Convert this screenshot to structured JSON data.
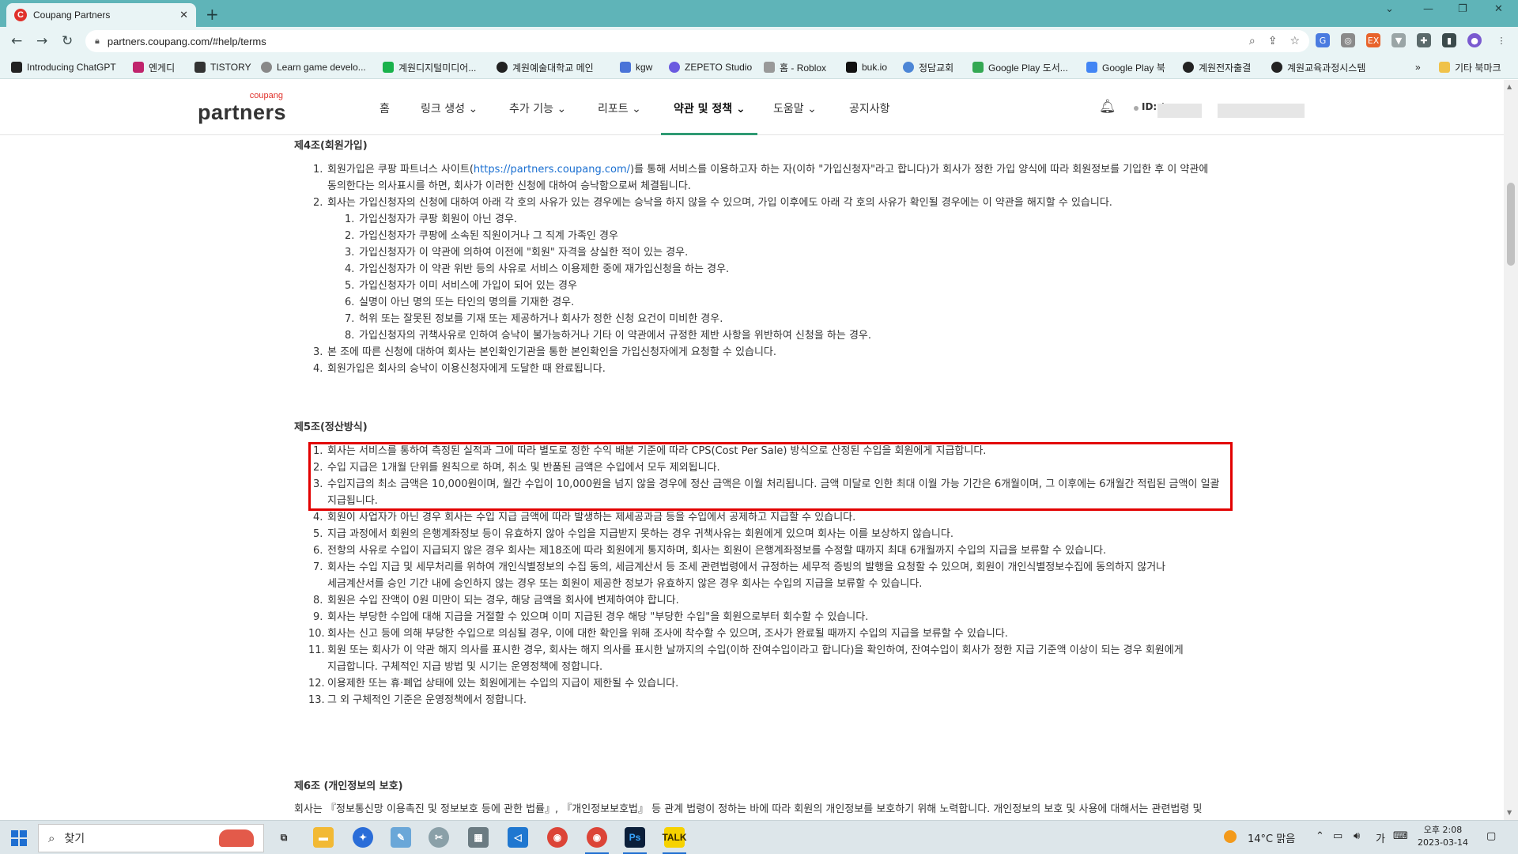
{
  "browser": {
    "tab_title": "Coupang Partners",
    "tab_favicon": "C",
    "url": "partners.coupang.com/#help/terms"
  },
  "bookmarks": [
    {
      "label": "Introducing ChatGPT",
      "color": "#222"
    },
    {
      "label": "엔게디",
      "color": "#c0246c"
    },
    {
      "label": "TISTORY",
      "color": "#333"
    },
    {
      "label": "Learn game develo...",
      "color": "#888"
    },
    {
      "label": "계원디지털미디어...",
      "color": "#19b24b"
    },
    {
      "label": "계원예술대학교 메인",
      "color": "#222"
    },
    {
      "label": "kgw",
      "color": "#4a74d8"
    },
    {
      "label": "ZEPETO Studio",
      "color": "#6a5ae0"
    },
    {
      "label": "홈 - Roblox",
      "color": "#999"
    },
    {
      "label": "buk.io",
      "color": "#111"
    },
    {
      "label": "정담교회",
      "color": "#4c86d6"
    },
    {
      "label": "Google Play 도서...",
      "color": "#34a853"
    },
    {
      "label": "Google Play 북",
      "color": "#4285f4"
    },
    {
      "label": "계원전자출결",
      "color": "#222"
    },
    {
      "label": "계원교육과정시스템",
      "color": "#222"
    }
  ],
  "bookmarks_more": "»",
  "bookmarks_other": "기타 북마크",
  "site": {
    "logo_sub": "coupang",
    "logo_main": "partners",
    "nav": [
      "홈",
      "링크 생성",
      "추가 기능",
      "리포트",
      "약관 및 정책",
      "도움말",
      "공지사항"
    ],
    "user_label": "ID: /"
  },
  "article": {
    "art4_title": "제4조(회원가입)",
    "art4_item1_a_pre": "회원가입은 쿠팡 파트너스 사이트(",
    "art4_item1_a_link": "https://partners.coupang.com/",
    "art4_item1_a_post": ")를 통해 서비스를 이용하고자 하는 자(이하 \"가입신청자\"라고 합니다)가 회사가 정한 가입 양식에 따라 회원정보를 기입한 후 이 약관에",
    "art4_item1_b": "동의한다는 의사표시를 하면, 회사가 이러한 신청에 대하여 승낙함으로써 체결됩니다.",
    "art4_item2": "회사는 가입신청자의 신청에 대하여 아래 각 호의 사유가 있는 경우에는 승낙을 하지 않을 수 있으며, 가입 이후에도 아래 각 호의 사유가 확인될 경우에는 이 약관을 해지할 수 있습니다.",
    "art4_sub": [
      "가입신청자가 쿠팡 회원이 아닌 경우.",
      "가입신청자가 쿠팡에 소속된 직원이거나 그 직계 가족인 경우",
      "가입신청자가 이 약관에 의하여 이전에 \"회원\" 자격을 상실한 적이 있는 경우.",
      "가입신청자가 이 약관 위반 등의 사유로 서비스 이용제한 중에 재가입신청을 하는 경우.",
      "가입신청자가 이미 서비스에 가입이 되어 있는 경우",
      "실명이 아닌 명의 또는 타인의 명의를 기재한 경우.",
      "허위 또는 잘못된 정보를 기재 또는 제공하거나 회사가 정한 신청 요건이 미비한 경우.",
      "가입신청자의 귀책사유로 인하여 승낙이 불가능하거나 기타 이 약관에서 규정한 제반 사항을 위반하여 신청을 하는 경우."
    ],
    "art4_item3": "본 조에 따른 신청에 대하여 회사는 본인확인기관을 통한 본인확인을 가입신청자에게 요청할 수 있습니다.",
    "art4_item4": "회원가입은 회사의 승낙이 이용신청자에게 도달한 때 완료됩니다.",
    "art5_title": "제5조(정산방식)",
    "art5_items": [
      "회사는 서비스를 통하여 측정된 실적과 그에 따라 별도로 정한 수익 배분 기준에 따라 CPS(Cost Per Sale) 방식으로 산정된 수입을 회원에게 지급합니다.",
      "수입 지급은 1개월 단위를 원칙으로 하며, 취소 및 반품된 금액은 수입에서 모두 제외됩니다.",
      "수입지급의 최소 금액은 10,000원이며, 월간 수입이 10,000원을 넘지 않을 경우에 정산 금액은 이월 처리됩니다. 금액 미달로 인한 최대 이월 가능 기간은 6개월이며, 그 이후에는 6개월간 적립된 금액이 일괄",
      "회원이 사업자가 아닌 경우 회사는 수입 지급 금액에 따라 발생하는 제세공과금 등을 수입에서 공제하고 지급할 수 있습니다.",
      "지급 과정에서 회원의 은행계좌정보 등이 유효하지 않아 수입을 지급받지 못하는 경우 귀책사유는 회원에게 있으며 회사는 이를 보상하지 않습니다.",
      "전항의 사유로 수입이 지급되지 않은 경우 회사는 제18조에 따라 회원에게 통지하며, 회사는 회원이 은행계좌정보를 수정할 때까지 최대 6개월까지 수입의 지급을 보류할 수 있습니다.",
      "회사는 수입 지급 및 세무처리를 위하여 개인식별정보의 수집 동의, 세금계산서 등 조세 관련법령에서 규정하는 세무적 증빙의 발행을 요청할 수 있으며, 회원이 개인식별정보수집에 동의하지 않거나",
      "회원은 수입 잔액이 0원 미만이 되는 경우, 해당 금액을 회사에 변제하여야 합니다.",
      "회사는 부당한 수입에 대해 지급을 거절할 수 있으며 이미 지급된 경우 해당 \"부당한 수입\"을 회원으로부터 회수할 수 있습니다.",
      "회사는 신고 등에 의해 부당한 수입으로 의심될 경우, 이에 대한 확인을 위해 조사에 착수할 수 있으며, 조사가 완료될 때까지 수입의 지급을 보류할 수 있습니다.",
      "회원 또는 회사가 이 약관 해지 의사를 표시한 경우, 회사는 해지 의사를 표시한 날까지의 수입(이하 잔여수입이라고 합니다)을 확인하여, 잔여수입이 회사가 정한 지급 기준액 이상이 되는 경우 회원에게",
      "이용제한 또는 휴·폐업 상태에 있는 회원에게는 수입의 지급이 제한될 수 있습니다.",
      "그 외 구체적인 기준은 운영정책에서 정합니다."
    ],
    "art5_item3_cont": "지급됩니다.",
    "art5_item7_cont": "세금계산서를 승인 기간 내에 승인하지 않는 경우 또는 회원이 제공한 정보가 유효하지 않은 경우 회사는 수입의 지급을 보류할 수 있습니다.",
    "art5_item11_cont": "지급합니다. 구체적인 지급 방법 및 시기는 운영정책에 정합니다.",
    "art6_title": "제6조 (개인정보의 보호)",
    "art6_para": "회사는 『정보통신망 이용촉진 및 정보보호 등에 관한 법률』, 『개인정보보호법』 등 관계 법령이 정하는 바에 따라 회원의 개인정보를 보호하기 위해 노력합니다. 개인정보의 보호 및 사용에 대해서는 관련법령 및"
  },
  "taskbar": {
    "search_label": "찾기",
    "weather": "14°C 맑음",
    "ime": "가",
    "time": "오후 2:08",
    "date": "2023-03-14"
  },
  "colors": {
    "highlight": "#e20000",
    "nav_active": "#2f9a73",
    "link": "#1a6fd1",
    "chrome_frame": "#5fb4b8"
  }
}
